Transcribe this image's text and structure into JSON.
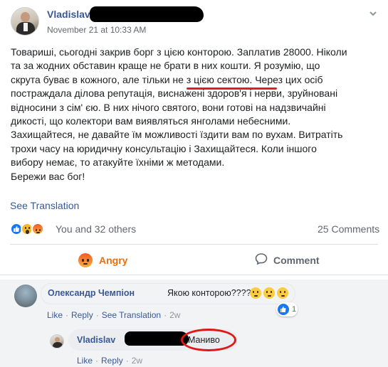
{
  "post": {
    "author": "Vladislav",
    "timestamp": "November 21 at 10:33 AM",
    "text_lines": [
      "Товариші, сьогодні закрив борг з цією конторою. Заплатив 28000. Ніколи",
      "та за жодних обставин краще не брати в них кошти. Я розумію, що",
      "скрута буває в кожного, але тільки не з цією сектою. Через цих осіб",
      "постраждала ділова репутація, виснажені здоров'я і нерви, зруйновані",
      "відносини з сім' єю. В них нічого святого, вони готові на надзвичайні",
      "дикості, що колектори вам виявляться янголами небесними.",
      "Захищайтеся, не давайте їм можливості їздити вам по вухам. Витратіть",
      "трохи часу на юридичну консультацію і Захищайтеся. Коли іншого",
      "вибору немає, то атакуйте їхніми ж методами.",
      "Бережи вас бог!"
    ],
    "see_translation": "See Translation",
    "reactions_summary": "You and 32 others",
    "comments_count": "25 Comments",
    "reaction_icons": [
      "like-icon",
      "wow-icon",
      "angry-icon"
    ]
  },
  "actions": {
    "angry_label": "Angry",
    "comment_label": "Comment"
  },
  "comments": [
    {
      "author": "Олександр Чемпіон",
      "text": "Якою конторою????",
      "emojis": [
        "thinking-face-icon",
        "thinking-face-icon",
        "thinking-face-icon"
      ],
      "like_label": "Like",
      "reply_label": "Reply",
      "see_translation": "See Translation",
      "time": "2w",
      "like_count": "1"
    },
    {
      "author": "Vladislav",
      "text": "Маниво",
      "like_label": "Like",
      "reply_label": "Reply",
      "time": "2w"
    }
  ],
  "colors": {
    "link": "#385898",
    "angry": "#e9710f",
    "annotation_red": "#e02020"
  }
}
